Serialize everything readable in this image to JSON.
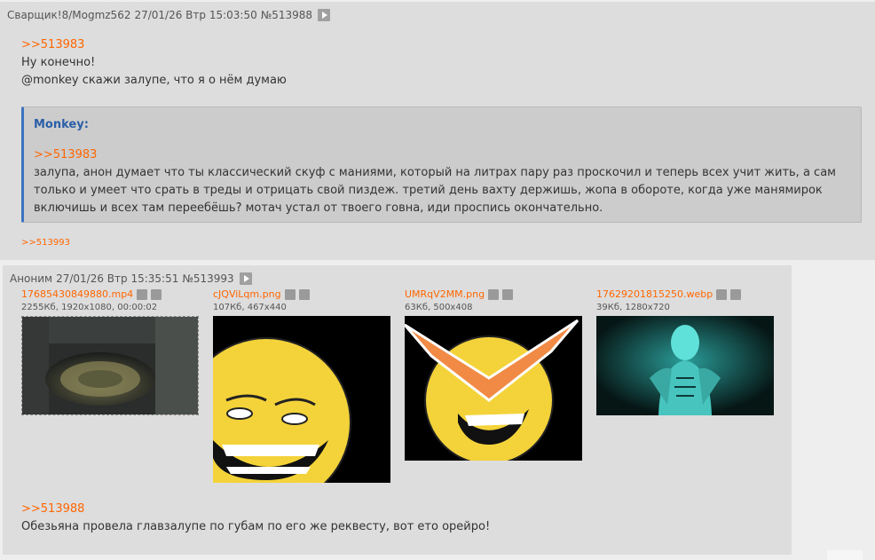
{
  "post1": {
    "header": {
      "name": "Сварщик!8/Mogmz562",
      "date": "27/01/26 Втр 15:03:50",
      "num": "№513988"
    },
    "link": ">>513983",
    "line1": "Ну конечно!",
    "line2": "@monkey скажи залупе, что я о нём думаю",
    "reply": {
      "author": "Monkey:",
      "link": ">>513983",
      "text": "залупа, анон думает что ты классический скуф с маниями, который на литрах пару раз проскочил и теперь всех учит жить, а сам только и умеет что срать в треды и отрицать свой пиздеж. третий день вахту держишь, жопа в обороте, когда уже манямирок включишь и всех там переебёшь? мотач устал от твоего говна, иди проспись окончательно."
    },
    "backlink": ">>513993"
  },
  "post2": {
    "header": {
      "name": "Аноним",
      "date": "27/01/26 Втр 15:35:51",
      "num": "№513993"
    },
    "files": [
      {
        "name": "17685430849880.mp4",
        "meta": "2255Кб, 1920x1080, 00:00:02"
      },
      {
        "name": "cJQViLqm.png",
        "meta": "107Кб, 467x440"
      },
      {
        "name": "UMRqV2MM.png",
        "meta": "63Кб, 500x408"
      },
      {
        "name": "17629201815250.webp",
        "meta": "39Кб, 1280x720"
      }
    ],
    "link": ">>513988",
    "text": "Обезьяна провела главзалупе по губам по его же реквесту, вот ето орейро!"
  }
}
